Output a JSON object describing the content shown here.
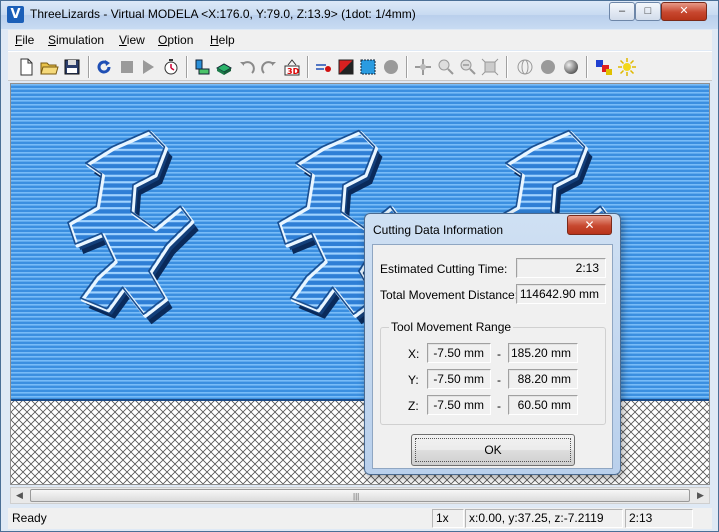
{
  "window": {
    "title": "ThreeLizards - Virtual MODELA <X:176.0, Y:79.0, Z:13.9> (1dot: 1/4mm)",
    "app_icon_letter": "V",
    "caption_minimize": "–",
    "caption_maximize": "□",
    "caption_close": "✕"
  },
  "menu": {
    "items": [
      {
        "mnemonic": "F",
        "rest": "ile"
      },
      {
        "mnemonic": "S",
        "rest": "imulation"
      },
      {
        "mnemonic": "V",
        "rest": "iew"
      },
      {
        "mnemonic": "O",
        "rest": "ption"
      },
      {
        "mnemonic": "H",
        "rest": "elp"
      }
    ]
  },
  "toolbar": {
    "icons": [
      "new-file-icon",
      "open-folder-icon",
      "save-icon",
      "refresh-icon",
      "stop-icon",
      "play-icon",
      "timer-icon",
      "machine-icon",
      "workpiece-icon",
      "rotate-left-icon",
      "rotate-right-icon",
      "3d-view-icon",
      "cutting-path-icon",
      "red-shape-icon",
      "select-area-icon",
      "sphere-icon",
      "move-icon",
      "zoom-in-icon",
      "zoom-out-icon",
      "fit-icon",
      "render-wire-icon",
      "render-solid-icon",
      "render-shaded-icon",
      "colors-icon",
      "light-icon"
    ]
  },
  "scrollbar": {
    "left_arrow": "◀",
    "right_arrow": "▶",
    "grip": "|||"
  },
  "statusbar": {
    "ready": "Ready",
    "zoom": "1x",
    "coords": "x:0.00, y:37.25, z:-7.2119",
    "time": "2:13"
  },
  "dialog": {
    "title": "Cutting Data Information",
    "close_glyph": "✕",
    "estimated_time_label": "Estimated Cutting Time:",
    "estimated_time_value": "2:13",
    "total_distance_label": "Total Movement Distance:",
    "total_distance_value": "114642.90 mm",
    "range_group_title": "Tool Movement Range",
    "range_rows": [
      {
        "axis": "X:",
        "min": "-7.50 mm",
        "sep": "-",
        "max": "185.20 mm"
      },
      {
        "axis": "Y:",
        "min": "-7.50 mm",
        "sep": "-",
        "max": "88.20 mm"
      },
      {
        "axis": "Z:",
        "min": "-7.50 mm",
        "sep": "-",
        "max": "60.50 mm"
      }
    ],
    "ok_label": "OK"
  },
  "colors": {
    "work_blue": "#3b8fe0",
    "stripe_light": "#6fb6f7",
    "dialog_blue": "#bfd4ee",
    "close_red": "#c7472f"
  }
}
